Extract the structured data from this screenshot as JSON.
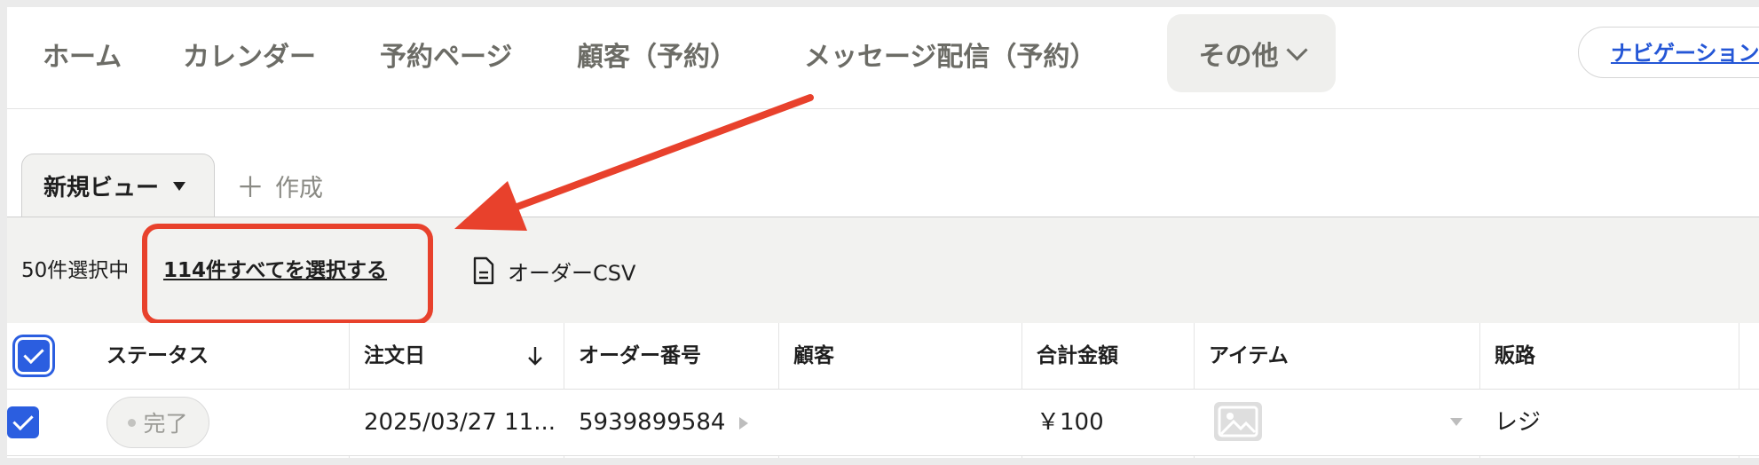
{
  "nav": {
    "items": [
      "ホーム",
      "カレンダー",
      "予約ページ",
      "顧客（予約）",
      "メッセージ配信（予約）"
    ],
    "more_label": "その他",
    "guide_label": "ナビゲーション"
  },
  "views": {
    "active_tab": "新規ビュー",
    "create_label": "作成"
  },
  "selection": {
    "count_label": "50件選択中",
    "select_all_label": "114件すべてを選択する",
    "csv_label": "オーダーCSV"
  },
  "table": {
    "columns": [
      "ステータス",
      "注文日",
      "オーダー番号",
      "顧客",
      "合計金額",
      "アイテム",
      "販路"
    ],
    "rows": [
      {
        "status": "完了",
        "order_date": "2025/03/27 11...",
        "order_number": "5939899584",
        "customer": "",
        "total": "￥100",
        "channel": "レジ"
      }
    ]
  },
  "colors": {
    "accent": "#2b5ee0",
    "highlight": "#e8412c",
    "link": "#2456d6"
  },
  "icons": [
    "chevron-down-icon",
    "caret-down-icon",
    "plus-icon",
    "document-icon",
    "checkmark-icon",
    "sort-down-arrow-icon",
    "image-placeholder-icon",
    "caret-right-icon",
    "arrow-annotation"
  ]
}
